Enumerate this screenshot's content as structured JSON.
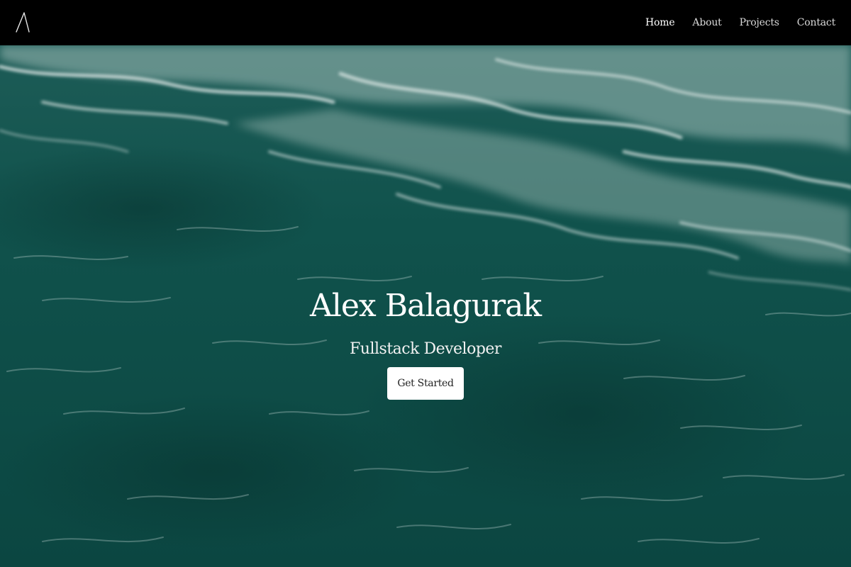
{
  "brand": {
    "logo_icon": "a-letter-logo-icon"
  },
  "nav": {
    "items": [
      {
        "label": "Home",
        "active": true
      },
      {
        "label": "About",
        "active": false
      },
      {
        "label": "Projects",
        "active": false
      },
      {
        "label": "Contact",
        "active": false
      }
    ]
  },
  "hero": {
    "title": "Alex Balagurak",
    "subtitle": "Fullstack Developer",
    "cta_label": "Get Started",
    "background": "ocean-water-photo"
  },
  "colors": {
    "navbar_bg": "#000000",
    "water_deep": "#0d4a45",
    "water_mid": "#1a6a62",
    "foam": "#d8e4e2",
    "button_bg": "#ffffff"
  }
}
